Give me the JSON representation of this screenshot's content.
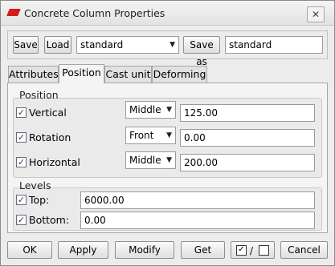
{
  "window": {
    "title": "Concrete Column Properties",
    "close_glyph": "✕"
  },
  "toolbar": {
    "save_label": "Save",
    "load_label": "Load",
    "preset_selected": "standard",
    "save_as_label": "Save as",
    "save_as_value": "standard"
  },
  "tabs": [
    {
      "label": "Attributes",
      "active": false
    },
    {
      "label": "Position",
      "active": true
    },
    {
      "label": "Cast unit",
      "active": false
    },
    {
      "label": "Deforming",
      "active": false
    }
  ],
  "position_group": {
    "title": "Position",
    "rows": [
      {
        "label": "Vertical",
        "checked": true,
        "option": "Middle",
        "value": "125.00"
      },
      {
        "label": "Rotation",
        "checked": true,
        "option": "Front",
        "value": "0.00"
      },
      {
        "label": "Horizontal",
        "checked": true,
        "option": "Middle",
        "value": "200.00"
      }
    ]
  },
  "levels_group": {
    "title": "Levels",
    "rows": [
      {
        "label": "Top:",
        "checked": true,
        "value": "6000.00"
      },
      {
        "label": "Bottom:",
        "checked": true,
        "value": "0.00"
      }
    ]
  },
  "footer": {
    "ok_label": "OK",
    "apply_label": "Apply",
    "modify_label": "Modify",
    "get_label": "Get",
    "toggle_separator": "/",
    "cancel_label": "Cancel"
  },
  "icons": {
    "app": "tekla-app-icon",
    "close": "close-icon",
    "dropdown": "chevron-down-icon",
    "check": "checkmark-icon"
  },
  "colors": {
    "app_icon": "#d51a1a",
    "check": "#1f3a8a"
  }
}
